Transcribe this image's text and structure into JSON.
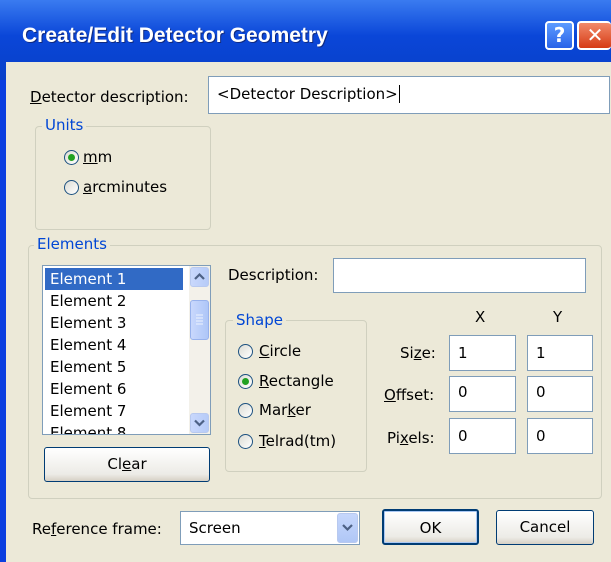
{
  "window": {
    "title": "Create/Edit Detector Geometry",
    "help_glyph": "?",
    "close_glyph": "✕"
  },
  "detector": {
    "label_pre": "",
    "label_acc": "D",
    "label_post": "etector description:",
    "value": "<Detector Description>"
  },
  "units": {
    "title": "Units",
    "options": [
      {
        "pre": "",
        "acc": "m",
        "post": "m",
        "selected": true
      },
      {
        "pre": "",
        "acc": "a",
        "post": "rcminutes",
        "selected": false
      }
    ]
  },
  "elements": {
    "title": "Elements",
    "list": [
      "Element 1",
      "Element 2",
      "Element 3",
      "Element 4",
      "Element 5",
      "Element 6",
      "Element 7",
      "Element 8"
    ],
    "selected_index": 0,
    "clear_pre": "Cl",
    "clear_acc": "e",
    "clear_post": "ar",
    "description_label": "Description:",
    "description_value": "",
    "shape": {
      "title": "Shape",
      "options": [
        {
          "pre": "",
          "acc": "C",
          "post": "ircle",
          "selected": false
        },
        {
          "pre": "",
          "acc": "R",
          "post": "ectangle",
          "selected": true
        },
        {
          "pre": "Mar",
          "acc": "k",
          "post": "er",
          "selected": false
        },
        {
          "pre": "",
          "acc": "T",
          "post": "elrad(tm)",
          "selected": false
        }
      ]
    },
    "x_header": "X",
    "y_header": "Y",
    "size": {
      "pre": "Si",
      "acc": "z",
      "post": "e:",
      "x": "1",
      "y": "1"
    },
    "offset": {
      "pre": "",
      "acc": "O",
      "post": "ffset:",
      "x": "0",
      "y": "0"
    },
    "pixels": {
      "pre": "Pi",
      "acc": "x",
      "post": "els:",
      "x": "0",
      "y": "0"
    }
  },
  "reference": {
    "pre": "Re",
    "acc": "f",
    "post": "erence frame:",
    "value": "Screen"
  },
  "buttons": {
    "ok": "OK",
    "cancel": "Cancel"
  }
}
